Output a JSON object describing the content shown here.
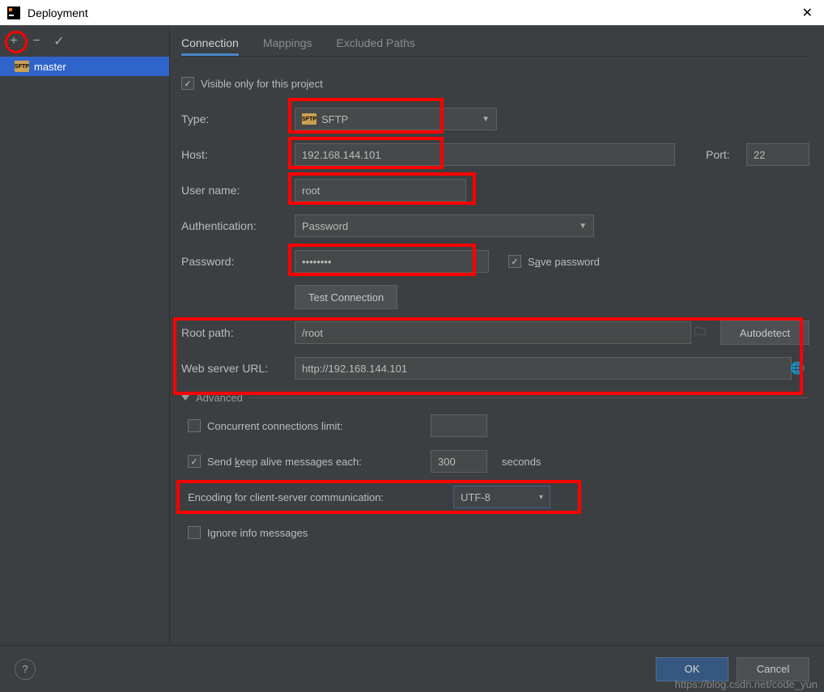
{
  "window": {
    "title": "Deployment"
  },
  "sidebar": {
    "server_name": "master"
  },
  "tabs": {
    "connection": "Connection",
    "mappings": "Mappings",
    "excluded": "Excluded Paths"
  },
  "form": {
    "visible_only_label": "Visible only for this project",
    "visible_only_checked": true,
    "type_label": "Type:",
    "type_value": "SFTP",
    "host_label": "Host:",
    "host_value": "192.168.144.101",
    "port_label": "Port:",
    "port_value": "22",
    "user_label": "User name:",
    "user_value": "root",
    "auth_label": "Authentication:",
    "auth_value": "Password",
    "password_label": "Password:",
    "password_value": "••••••••",
    "save_password_label": "Save password",
    "save_password_checked": true,
    "test_connection_label": "Test Connection",
    "root_path_label": "Root path:",
    "root_path_value": "/root",
    "autodetect_label": "Autodetect",
    "web_url_label": "Web server URL:",
    "web_url_value": "http://192.168.144.101"
  },
  "advanced": {
    "header": "Advanced",
    "concurrent_label": "Concurrent connections limit:",
    "concurrent_checked": false,
    "concurrent_value": "",
    "keepalive_label_pre": "Send ",
    "keepalive_label_key": "k",
    "keepalive_label_post": "eep alive messages each:",
    "keepalive_checked": true,
    "keepalive_value": "300",
    "keepalive_unit": "seconds",
    "encoding_label": "Encoding for client-server communication:",
    "encoding_value": "UTF-8",
    "ignore_info_label": "Ignore info messages",
    "ignore_info_checked": false
  },
  "footer": {
    "ok": "OK",
    "cancel": "Cancel"
  },
  "watermark": "https://blog.csdn.net/code_yun"
}
